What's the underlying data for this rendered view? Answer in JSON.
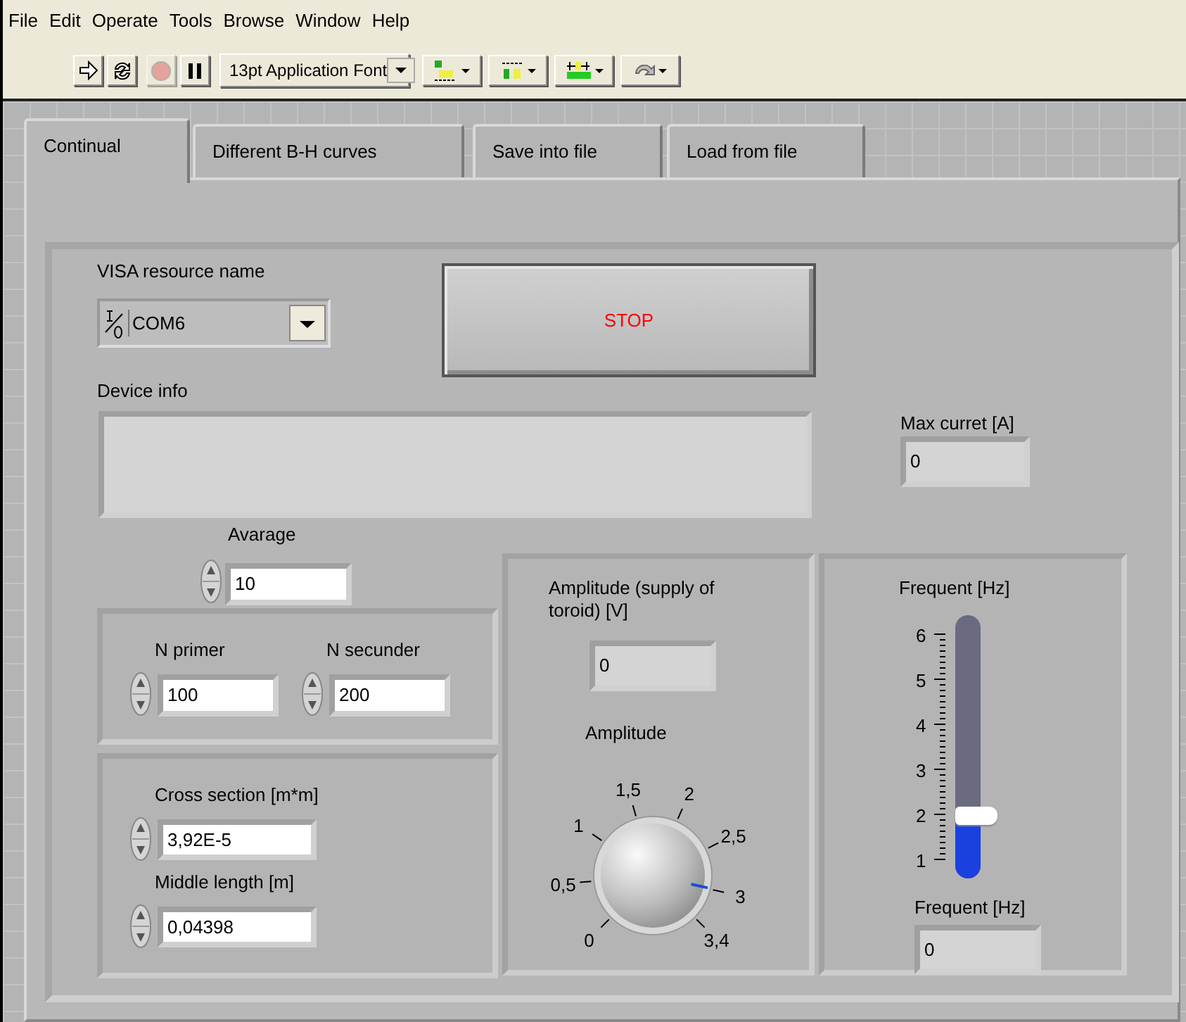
{
  "menu": [
    "File",
    "Edit",
    "Operate",
    "Tools",
    "Browse",
    "Window",
    "Help"
  ],
  "toolbar": {
    "buttons": [
      {
        "kind": "run",
        "disabled": false
      },
      {
        "kind": "run-continuously",
        "disabled": false
      },
      {
        "kind": "abort",
        "disabled": true
      },
      {
        "kind": "pause",
        "disabled": false
      }
    ],
    "font": "13pt Application Font",
    "tools": [
      {
        "kind": "align"
      },
      {
        "kind": "distribute"
      },
      {
        "kind": "resize"
      },
      {
        "kind": "reorder"
      }
    ]
  },
  "tabs": [
    {
      "label": "Continual",
      "selected": true
    },
    {
      "label": "Different B-H curves",
      "selected": false
    },
    {
      "label": "Save into file",
      "selected": false
    },
    {
      "label": "Load from file",
      "selected": false
    }
  ],
  "panel": {
    "visa": {
      "label": "VISA resource name",
      "value": "COM6"
    },
    "stop_button": "STOP",
    "device_info": {
      "label": "Device info"
    },
    "max_current": {
      "label": "Max curret [A]",
      "value": "0"
    },
    "average": {
      "label": "Avarage",
      "value": "10"
    },
    "n_primer": {
      "label": "N primer",
      "value": "100"
    },
    "n_secunder": {
      "label": "N secunder",
      "value": "200"
    },
    "cross_section": {
      "label": "Cross section [m*m]",
      "value": "3,92E-5"
    },
    "middle_length": {
      "label": "Middle length [m]",
      "value": "0,04398"
    },
    "amplitude_indicator": {
      "label": "Amplitude (supply of toroid) [V]",
      "value": "0"
    },
    "amplitude_knob": {
      "label": "Amplitude",
      "scale": [
        "0",
        "0,5",
        "1",
        "1,5",
        "2",
        "2,5",
        "3",
        "3,4"
      ]
    },
    "frequency_slider": {
      "label": "Frequent [Hz]",
      "level": 0.2,
      "scale": [
        "6",
        "5",
        "4",
        "3",
        "2",
        "1"
      ]
    },
    "frequency_indicator": {
      "label": "Frequent [Hz]",
      "value": "0"
    }
  }
}
